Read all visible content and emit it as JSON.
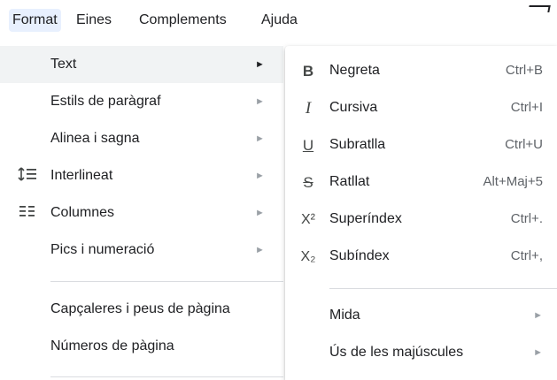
{
  "menubar": {
    "items": [
      "Format",
      "Eines",
      "Complements",
      "Ajuda"
    ],
    "active": "Format"
  },
  "format_menu": {
    "items": [
      {
        "label": "Text",
        "icon": "",
        "arrow": "►"
      },
      {
        "label": "Estils de paràgraf",
        "icon": "",
        "arrow": "►"
      },
      {
        "label": "Alinea i sagna",
        "icon": "",
        "arrow": "►"
      },
      {
        "label": "Interlineat",
        "icon": "line-spacing-icon",
        "glyph": "↕☰",
        "arrow": "►"
      },
      {
        "label": "Columnes",
        "icon": "columns-icon",
        "glyph": "☷",
        "arrow": "►"
      },
      {
        "label": "Pics i numeració",
        "icon": "",
        "arrow": "►"
      },
      {
        "label": "Capçaleres i peus de pàgina",
        "icon": ""
      },
      {
        "label": "Números de pàgina",
        "icon": ""
      }
    ]
  },
  "text_submenu": {
    "items": [
      {
        "label": "Negreta",
        "shortcut": "Ctrl+B",
        "icon": "bold-icon",
        "glyph": "B"
      },
      {
        "label": "Cursiva",
        "shortcut": "Ctrl+I",
        "icon": "italic-icon",
        "glyph": "I"
      },
      {
        "label": "Subratlla",
        "shortcut": "Ctrl+U",
        "icon": "underline-icon",
        "glyph": "U"
      },
      {
        "label": "Ratllat",
        "shortcut": "Alt+Maj+5",
        "icon": "strikethrough-icon",
        "glyph": "S"
      },
      {
        "label": "Superíndex",
        "shortcut": "Ctrl+.",
        "icon": "superscript-icon",
        "glyph": "X²"
      },
      {
        "label": "Subíndex",
        "shortcut": "Ctrl+,",
        "icon": "subscript-icon",
        "glyph": "X₂"
      },
      {
        "label": "Mida",
        "arrow": "►"
      },
      {
        "label": "Ús de les majúscules",
        "arrow": "►"
      }
    ]
  },
  "colors": {
    "active_menu_bg": "#e8f0fe",
    "hover_item_bg": "#f1f3f4",
    "separator": "#dadce0"
  }
}
